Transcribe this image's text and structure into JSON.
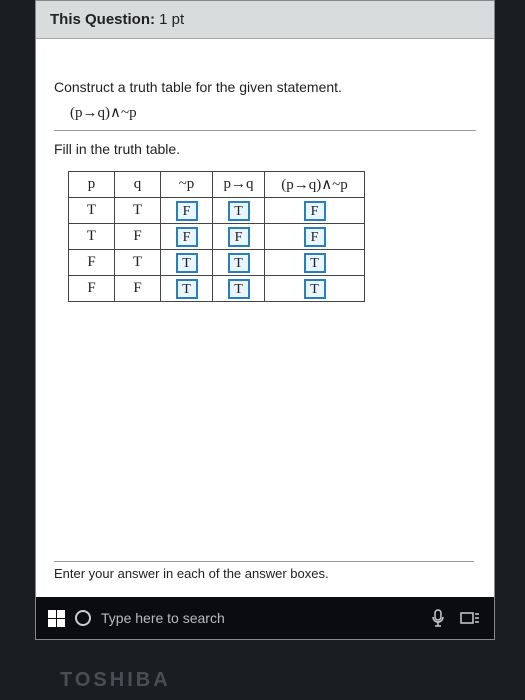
{
  "header": {
    "label": "This Question:",
    "points": "1 pt"
  },
  "instructions": {
    "construct": "Construct a truth table for the given statement.",
    "expression": "(p→q)∧~p",
    "fill": "Fill in the truth table."
  },
  "table": {
    "headers": [
      "p",
      "q",
      "~p",
      "p→q",
      "(p→q)∧~p"
    ],
    "rows": [
      {
        "p": "T",
        "q": "T",
        "notp": "F",
        "impl": "T",
        "res": "F"
      },
      {
        "p": "T",
        "q": "F",
        "notp": "F",
        "impl": "F",
        "res": "F"
      },
      {
        "p": "F",
        "q": "T",
        "notp": "T",
        "impl": "T",
        "res": "T"
      },
      {
        "p": "F",
        "q": "F",
        "notp": "T",
        "impl": "T",
        "res": "T"
      }
    ]
  },
  "footer_note": "Enter your answer in each of the answer boxes.",
  "taskbar": {
    "search_placeholder": "Type here to search"
  },
  "brand": "TOSHIBA"
}
